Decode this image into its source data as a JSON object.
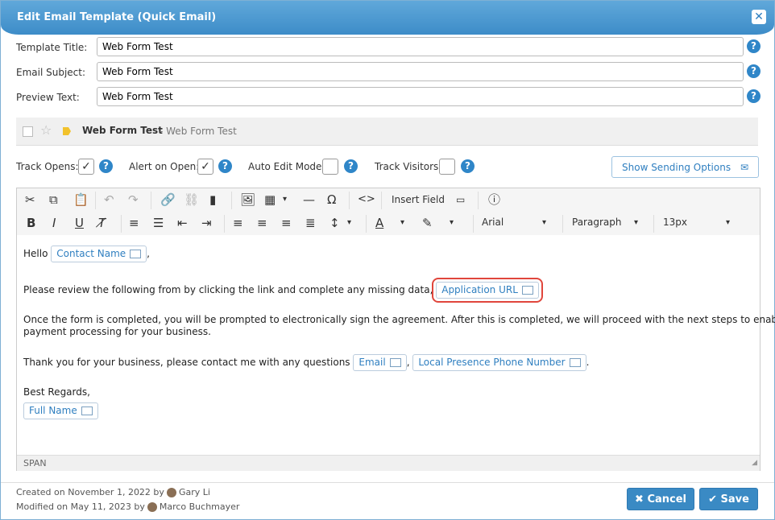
{
  "dialog": {
    "title": "Edit Email Template (Quick Email)",
    "close_icon": "close-icon"
  },
  "fields": {
    "template_title_label": "Template Title:",
    "template_title_value": "Web Form Test",
    "email_subject_label": "Email Subject:",
    "email_subject_value": "Web Form Test",
    "preview_text_label": "Preview Text:",
    "preview_text_value": "Web Form Test"
  },
  "template_bar": {
    "name": "Web Form Test",
    "subtitle": "- Web Form Test"
  },
  "options": {
    "track_opens": {
      "label": "Track Opens:",
      "checked": true
    },
    "alert_on_open": {
      "label": "Alert on Open:",
      "checked": true
    },
    "auto_edit_mode": {
      "label": "Auto Edit Mode:",
      "checked": false
    },
    "track_visitors": {
      "label": "Track Visitors:",
      "checked": false
    },
    "show_sending_options": "Show Sending Options"
  },
  "toolbar": {
    "insert_field": "Insert Field",
    "font": "Arial",
    "block": "Paragraph",
    "size": "13px"
  },
  "body": {
    "hello": "Hello",
    "contact_name": "Contact Name",
    "line2": "Please review the following from by clicking the link and complete any missing data,",
    "application_url": "Application URL",
    "line3a": "Once the form is completed, you will be prompted to electronically sign the agreement. After this is completed, we will proceed with the next steps to enable",
    "line3b": "payment processing for your business.",
    "line4": "Thank you for your business, please contact me with any questions",
    "email": "Email",
    "local_phone": "Local Presence Phone Number",
    "regards": "Best Regards,",
    "full_name": "Full Name"
  },
  "status": "SPAN",
  "footer": {
    "created": "Created on November 1, 2022 by",
    "created_by": "Gary Li",
    "modified": "Modified on May 11, 2023 by",
    "modified_by": "Marco Buchmayer",
    "cancel": "Cancel",
    "save": "Save"
  }
}
